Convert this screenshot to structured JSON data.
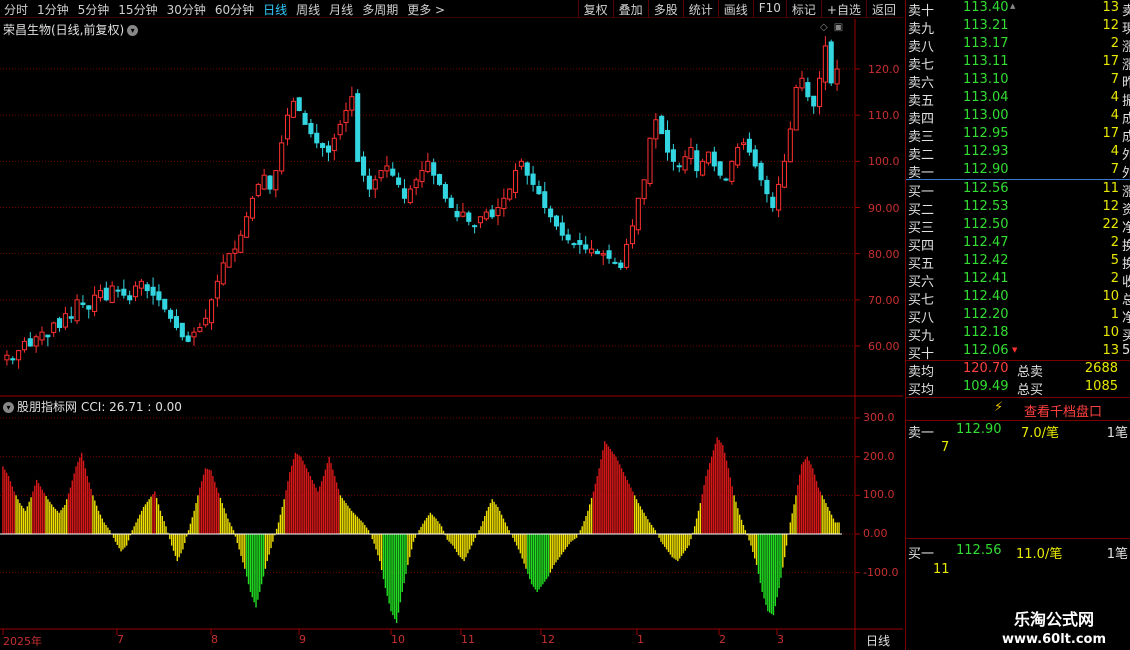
{
  "toolbar": {
    "periods": [
      "分时",
      "1分钟",
      "5分钟",
      "15分钟",
      "30分钟",
      "60分钟",
      "日线",
      "周线",
      "月线",
      "多周期",
      "更多 >"
    ],
    "active_period": "日线",
    "buttons": [
      "复权",
      "叠加",
      "多股",
      "统计",
      "画线",
      "F10",
      "标记",
      "+自选",
      "返回"
    ]
  },
  "stock": {
    "title": "荣昌生物(日线,前复权)",
    "price_ticks": [
      "120.0",
      "110.0",
      "100.0",
      "90.00",
      "80.00",
      "70.00",
      "60.00"
    ]
  },
  "indicator": {
    "title": "股朋指标网",
    "cci_text": "CCI: 26.71 : 0.00",
    "ticks": [
      "300.0",
      "200.0",
      "100.0",
      "0.00",
      "-100.0"
    ]
  },
  "dates": {
    "labels": [
      "2025年",
      "7",
      "8",
      "9",
      "10",
      "11",
      "12",
      "1",
      "2",
      "3"
    ],
    "period_label": "日线"
  },
  "colors": {
    "up": "#ff3030",
    "down": "#33d6e0",
    "cci_red": "#d81818",
    "cci_yellow": "#f0e000",
    "cci_green": "#22dd22",
    "grid": "#6a0000"
  },
  "chart_data": [
    {
      "type": "candlestick",
      "title": "荣昌生物(日线,前复权)",
      "ylim": [
        55,
        127
      ],
      "closes": [
        58,
        57,
        59,
        61,
        60,
        62,
        63,
        62,
        65,
        64,
        67,
        66,
        70,
        69,
        68,
        71,
        72,
        70,
        73,
        72,
        71,
        70,
        73,
        74,
        72,
        71,
        70,
        68,
        66,
        64,
        62,
        61,
        63,
        64,
        66,
        70,
        74,
        78,
        80,
        81,
        84,
        88,
        92,
        95,
        97,
        94,
        98,
        104,
        110,
        113,
        111,
        108,
        106,
        104,
        103,
        102,
        105,
        108,
        111,
        114,
        100,
        97,
        94,
        96,
        98,
        99,
        97,
        95,
        92,
        94,
        96,
        98,
        100,
        97,
        95,
        92,
        90,
        88,
        89,
        87,
        86,
        88,
        89,
        88,
        90,
        92,
        94,
        98,
        100,
        97,
        95,
        93,
        90,
        88,
        86,
        84,
        83,
        82,
        82,
        81,
        81,
        80,
        80,
        79,
        78,
        77,
        82,
        86,
        92,
        96,
        105,
        109,
        106,
        102,
        100,
        99,
        101,
        103,
        98,
        100,
        102,
        99,
        97,
        96,
        100,
        103,
        104,
        102,
        99,
        96,
        93,
        90,
        95,
        100,
        107,
        116,
        118,
        114,
        112,
        118,
        125,
        117,
        120
      ],
      "xlabels": [
        "2025年",
        "7",
        "8",
        "9",
        "10",
        "11",
        "12",
        "1",
        "2",
        "3"
      ]
    },
    {
      "type": "bar",
      "title": "股朋指标网",
      "series_label": "CCI",
      "current_value": 26.71,
      "ylim": [
        -230,
        320
      ],
      "values": [
        175,
        150,
        110,
        80,
        60,
        95,
        140,
        115,
        90,
        70,
        55,
        75,
        120,
        175,
        210,
        150,
        100,
        60,
        30,
        10,
        -20,
        -45,
        -30,
        10,
        40,
        70,
        90,
        110,
        60,
        20,
        -30,
        -70,
        -40,
        10,
        60,
        120,
        170,
        165,
        120,
        80,
        40,
        10,
        -40,
        -90,
        -150,
        -190,
        -130,
        -70,
        -20,
        30,
        90,
        160,
        210,
        200,
        170,
        140,
        110,
        150,
        200,
        150,
        100,
        80,
        60,
        45,
        30,
        10,
        -25,
        -70,
        -140,
        -200,
        -230,
        -150,
        -80,
        -20,
        10,
        35,
        55,
        40,
        20,
        -15,
        -30,
        -55,
        -70,
        -40,
        -10,
        20,
        60,
        90,
        70,
        40,
        10,
        -20,
        -50,
        -90,
        -130,
        -150,
        -130,
        -110,
        -80,
        -60,
        -40,
        -20,
        -10,
        20,
        60,
        110,
        170,
        240,
        220,
        200,
        170,
        140,
        110,
        80,
        55,
        30,
        10,
        -20,
        -40,
        -60,
        -70,
        -50,
        -30,
        20,
        80,
        150,
        200,
        250,
        230,
        170,
        100,
        50,
        10,
        -30,
        -80,
        -150,
        -200,
        -210,
        -140,
        -60,
        30,
        100,
        180,
        200,
        170,
        120,
        90,
        60,
        30
      ]
    }
  ],
  "orderbook": {
    "asks": [
      {
        "label": "卖十",
        "price": "113.40",
        "vol": "13",
        "edge": "卖"
      },
      {
        "label": "卖九",
        "price": "113.21",
        "vol": "12",
        "edge": "現"
      },
      {
        "label": "卖八",
        "price": "113.17",
        "vol": "2",
        "edge": "涨"
      },
      {
        "label": "卖七",
        "price": "113.11",
        "vol": "17",
        "edge": "涨"
      },
      {
        "label": "卖六",
        "price": "113.10",
        "vol": "7",
        "edge": "昨"
      },
      {
        "label": "卖五",
        "price": "113.04",
        "vol": "4",
        "edge": "振"
      },
      {
        "label": "卖四",
        "price": "113.00",
        "vol": "4",
        "edge": "成"
      },
      {
        "label": "卖三",
        "price": "112.95",
        "vol": "17",
        "edge": "成"
      },
      {
        "label": "卖二",
        "price": "112.93",
        "vol": "4",
        "edge": "外"
      },
      {
        "label": "卖一",
        "price": "112.90",
        "vol": "7",
        "edge": "外"
      }
    ],
    "bids": [
      {
        "label": "买一",
        "price": "112.56",
        "vol": "11",
        "edge": "涨"
      },
      {
        "label": "买二",
        "price": "112.53",
        "vol": "12",
        "edge": "资"
      },
      {
        "label": "买三",
        "price": "112.50",
        "vol": "22",
        "edge": "净"
      },
      {
        "label": "买四",
        "price": "112.47",
        "vol": "2",
        "edge": "换"
      },
      {
        "label": "买五",
        "price": "112.42",
        "vol": "5",
        "edge": "换"
      },
      {
        "label": "买六",
        "price": "112.41",
        "vol": "2",
        "edge": "收"
      },
      {
        "label": "买七",
        "price": "112.40",
        "vol": "10",
        "edge": "总"
      },
      {
        "label": "买八",
        "price": "112.20",
        "vol": "1",
        "edge": "净"
      },
      {
        "label": "买九",
        "price": "112.18",
        "vol": "10",
        "edge": "买"
      },
      {
        "label": "买十",
        "price": "112.06",
        "vol": "13",
        "edge": "5"
      }
    ],
    "ask_avg_label": "卖均",
    "ask_avg": "120.70",
    "ask_total_label": "总卖",
    "ask_total": "2688",
    "bid_avg_label": "买均",
    "bid_avg": "109.49",
    "bid_total_label": "总买",
    "bid_total": "1085",
    "view_button": "查看千档盘口",
    "queue1_label": "卖一",
    "queue1_price": "112.90",
    "queue1_avg": "7.0/笔",
    "queue1_count": "1笔",
    "queue1_detail": "7",
    "queue2_label": "买一",
    "queue2_price": "112.56",
    "queue2_avg": "11.0/笔",
    "queue2_count": "1笔",
    "queue2_detail": "11"
  },
  "watermark": {
    "line1": "乐淘公式网",
    "line2": "www.60lt.com"
  }
}
